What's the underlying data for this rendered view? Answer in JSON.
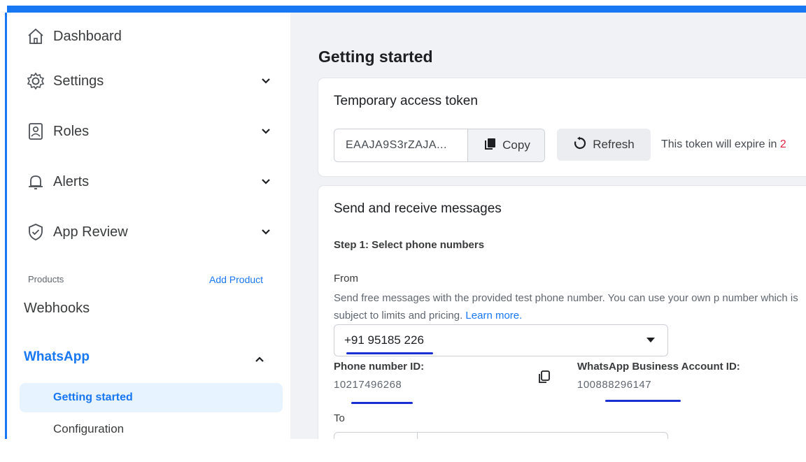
{
  "sidebar": {
    "items": [
      {
        "label": "Dashboard",
        "icon": "home-icon"
      },
      {
        "label": "Settings",
        "icon": "gear-icon"
      },
      {
        "label": "Roles",
        "icon": "id-badge-icon"
      },
      {
        "label": "Alerts",
        "icon": "bell-icon"
      },
      {
        "label": "App Review",
        "icon": "shield-check-icon"
      }
    ],
    "products_label": "Products",
    "add_product": "Add Product",
    "webhooks": "Webhooks",
    "whatsapp": "WhatsApp",
    "sub_items": [
      "Getting started",
      "Configuration"
    ]
  },
  "main": {
    "title": "Getting started",
    "token_card": {
      "title": "Temporary access token",
      "token": "EAAJA9S3rZAJA...",
      "copy_label": "Copy",
      "refresh_label": "Refresh",
      "expire_text": "This token will expire in",
      "expire_value": "2"
    },
    "messages_card": {
      "title": "Send and receive messages",
      "step1": "Step 1: Select phone numbers",
      "from_label": "From",
      "help_text": "Send free messages with the provided test phone number. You can use your own p number which is subject to limits and pricing.",
      "learn_more": "Learn more.",
      "from_value": "+91 95185 226",
      "phone_id_label": "Phone number ID:",
      "phone_id_value": "10217496268",
      "waba_label": "WhatsApp Business Account ID:",
      "waba_value": "100888296147",
      "to_label": "To"
    }
  },
  "colors": {
    "accent": "#1877f2",
    "annotation": "#1a2fd1",
    "expire_red": "#e41e3f"
  }
}
